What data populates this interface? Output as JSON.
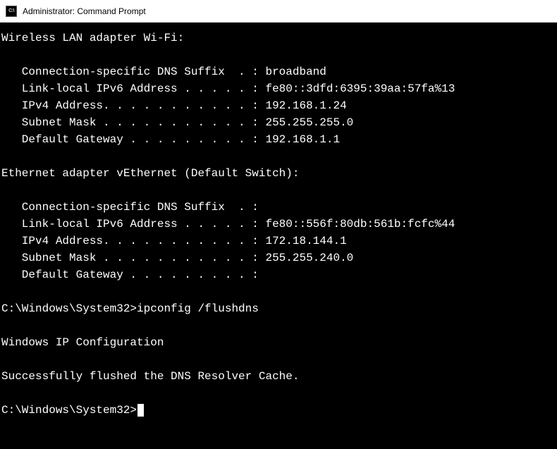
{
  "window": {
    "title": "Administrator: Command Prompt",
    "icon_label": "C:\\"
  },
  "output": {
    "adapter1": {
      "header": "Wireless LAN adapter Wi-Fi:",
      "rows": [
        {
          "label": "   Connection-specific DNS Suffix  . :",
          "value": " broadband"
        },
        {
          "label": "   Link-local IPv6 Address . . . . . :",
          "value": " fe80::3dfd:6395:39aa:57fa%13"
        },
        {
          "label": "   IPv4 Address. . . . . . . . . . . :",
          "value": " 192.168.1.24"
        },
        {
          "label": "   Subnet Mask . . . . . . . . . . . :",
          "value": " 255.255.255.0"
        },
        {
          "label": "   Default Gateway . . . . . . . . . :",
          "value": " 192.168.1.1"
        }
      ]
    },
    "adapter2": {
      "header": "Ethernet adapter vEthernet (Default Switch):",
      "rows": [
        {
          "label": "   Connection-specific DNS Suffix  . :",
          "value": ""
        },
        {
          "label": "   Link-local IPv6 Address . . . . . :",
          "value": " fe80::556f:80db:561b:fcfc%44"
        },
        {
          "label": "   IPv4 Address. . . . . . . . . . . :",
          "value": " 172.18.144.1"
        },
        {
          "label": "   Subnet Mask . . . . . . . . . . . :",
          "value": " 255.255.240.0"
        },
        {
          "label": "   Default Gateway . . . . . . . . . :",
          "value": ""
        }
      ]
    },
    "prompt1": "C:\\Windows\\System32>",
    "command1": "ipconfig /flushdns",
    "line_config": "Windows IP Configuration",
    "line_success": "Successfully flushed the DNS Resolver Cache.",
    "prompt2": "C:\\Windows\\System32>"
  }
}
